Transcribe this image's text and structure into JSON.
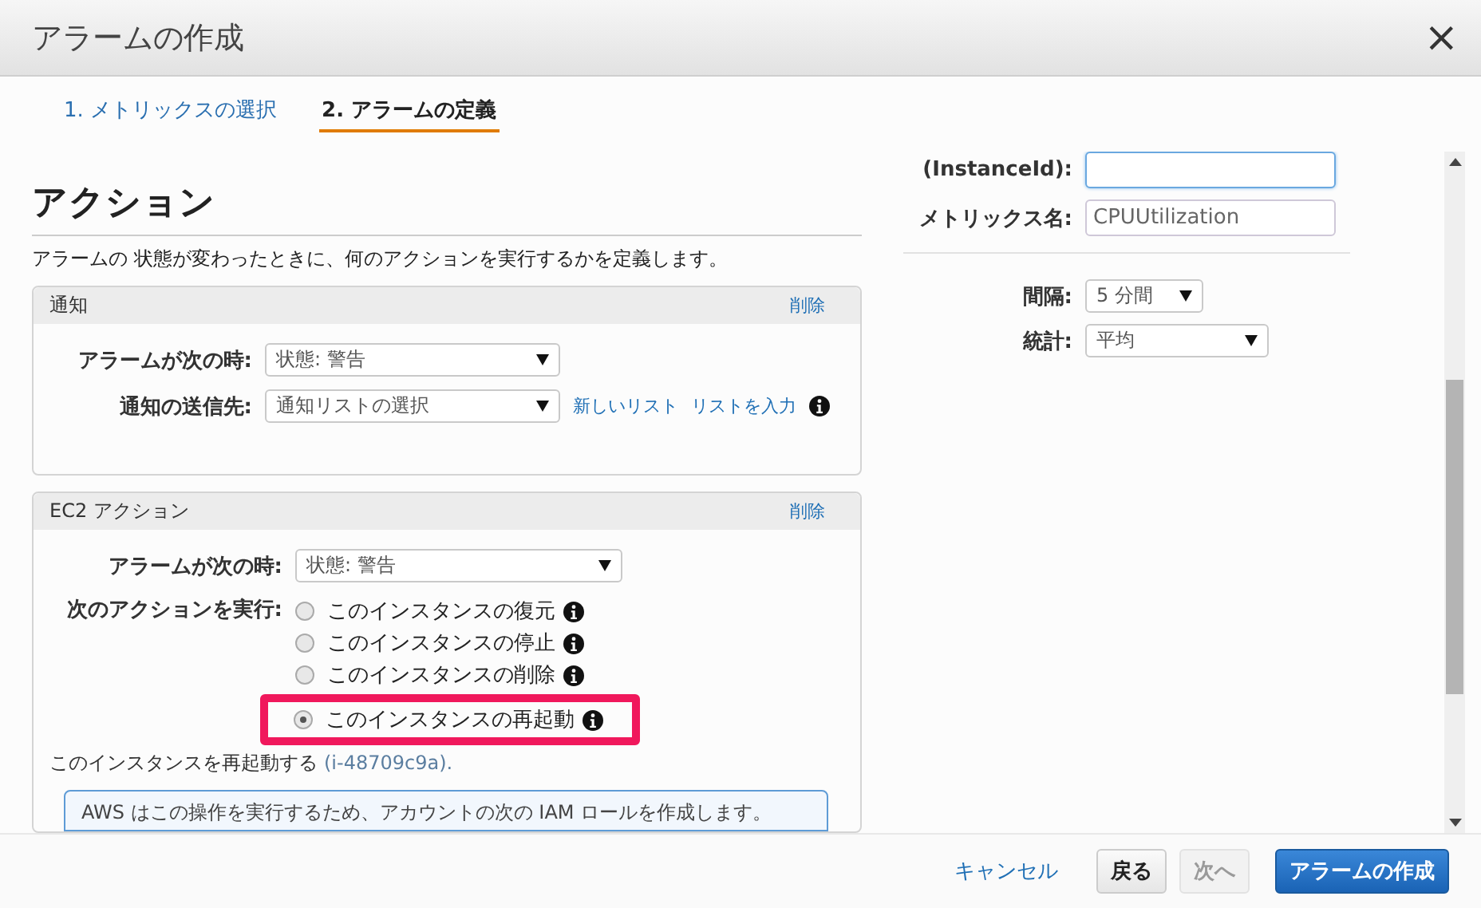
{
  "window": {
    "title": "アラームの作成",
    "close": "×"
  },
  "tabs": [
    {
      "label": "1. メトリックスの選択",
      "selected": false
    },
    {
      "label": "2. アラームの定義",
      "selected": true
    }
  ],
  "actions": {
    "heading": "アクション",
    "description": "アラームの 状態が変わったときに、何のアクションを実行するかを定義します。",
    "panels": [
      {
        "kind": "notification",
        "title": "通知",
        "remove": "削除",
        "rows": [
          {
            "label": "アラームが次の時:",
            "select": "状態: 警告"
          },
          {
            "label": "通知の送信先:",
            "select": "通知リストの選択",
            "links": [
              "新しいリスト",
              "リストを入力"
            ],
            "info": true
          }
        ]
      },
      {
        "kind": "ec2",
        "title": "EC2 アクション",
        "remove": "削除",
        "rows": [
          {
            "label": "アラームが次の時:",
            "select": "状態: 警告"
          }
        ],
        "action_label": "次のアクションを実行:",
        "options": [
          {
            "label": "このインスタンスの復元",
            "selected": false,
            "highlighted": false
          },
          {
            "label": "このインスタンスの停止",
            "selected": false,
            "highlighted": false
          },
          {
            "label": "このインスタンスの削除",
            "selected": false,
            "highlighted": false
          },
          {
            "label": "このインスタンスの再起動",
            "selected": true,
            "highlighted": true
          }
        ],
        "note": "このインスタンスを再起動する",
        "note_id": "(i-48709c9a).",
        "notice": "AWS はこの操作を実行するため、アカウントの次の IAM ロールを作成します。"
      }
    ]
  },
  "metric": {
    "fields": [
      {
        "label": "(InstanceId):",
        "focused": true
      },
      {
        "label": "メトリックス名:",
        "value": "CPUUtilization",
        "focused": false
      }
    ],
    "selects": [
      {
        "label": "間隔:",
        "value": "5 分間"
      },
      {
        "label": "統計:",
        "value": "平均"
      }
    ]
  },
  "footer": {
    "buttons": [
      {
        "kind": "link",
        "label": "キャンセル",
        "disabled": false
      },
      {
        "kind": "default",
        "label": "戻る",
        "disabled": false
      },
      {
        "kind": "default",
        "label": "次へ",
        "disabled": true
      },
      {
        "kind": "primary",
        "label": "アラームの作成",
        "disabled": false
      }
    ]
  }
}
